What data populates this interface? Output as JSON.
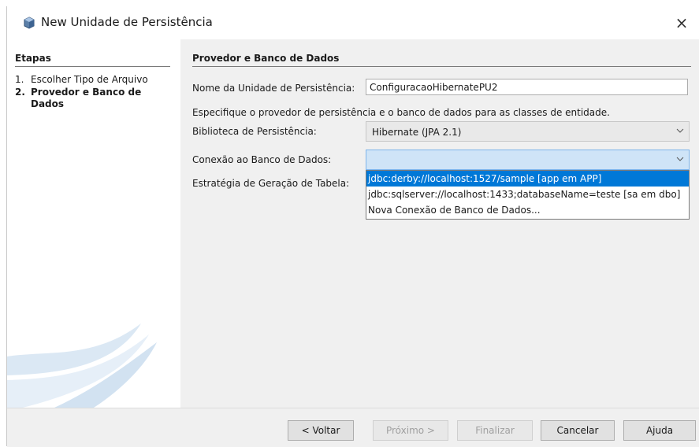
{
  "window": {
    "title": "New Unidade de Persistência",
    "title_icon": "cube-icon",
    "close_glyph": "×"
  },
  "steps": {
    "title": "Etapas",
    "items": [
      {
        "num": "1.",
        "label": "Escolher Tipo de Arquivo"
      },
      {
        "num": "2.",
        "label": "Provedor e Banco de Dados"
      }
    ]
  },
  "panel": {
    "title": "Provedor e Banco de Dados",
    "unit_name_label": "Nome da Unidade de Persistência:",
    "unit_name_value": "ConfiguracaoHibernatePU2",
    "description": "Especifique o provedor de persistência e o banco de dados para as classes de entidade.",
    "library_label": "Biblioteca de Persistência:",
    "library_value": "Hibernate (JPA 2.1)",
    "connection_label": "Conexão ao Banco de Dados:",
    "connection_value": "",
    "strategy_label": "Estratégia de Geração de Tabela:",
    "connection_options": [
      "jdbc:derby://localhost:1527/sample [app em APP]",
      "jdbc:sqlserver://localhost:1433;databaseName=teste [sa em dbo]",
      "Nova Conexão de Banco de Dados..."
    ],
    "selected_option_index": 0
  },
  "buttons": {
    "back": "< Voltar",
    "next": "Próximo >",
    "finish": "Finalizar",
    "cancel": "Cancelar",
    "help": "Ajuda"
  },
  "colors": {
    "selection": "#0078d7",
    "focused_combo": "#cfe4f7",
    "dialog_bg": "#f0f0f0"
  }
}
